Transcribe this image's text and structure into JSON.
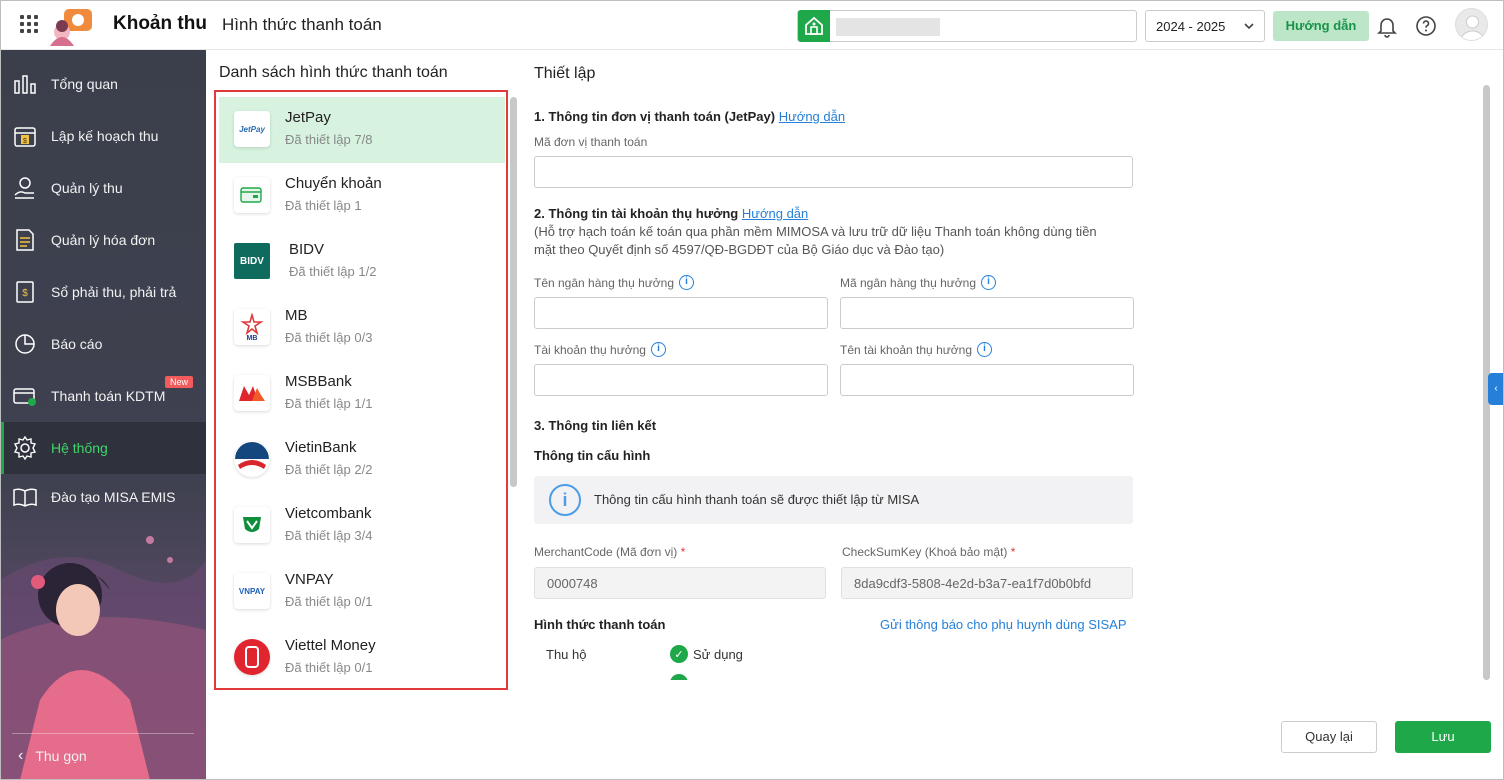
{
  "header": {
    "app_title": "Khoản thu",
    "page_title": "Hình thức thanh toán",
    "year": "2024 - 2025",
    "guide_label": "Hướng dẫn",
    "icons": [
      "apps-icon",
      "school-icon",
      "chevron-down-icon",
      "bell-icon",
      "help-icon",
      "avatar"
    ]
  },
  "sidebar": {
    "items": [
      {
        "label": "Tổng quan",
        "icon": "chart-icon"
      },
      {
        "label": "Lập kế hoạch thu",
        "icon": "calendar-money-icon"
      },
      {
        "label": "Quản lý thu",
        "icon": "money-hand-icon"
      },
      {
        "label": "Quản lý hóa đơn",
        "icon": "invoice-icon"
      },
      {
        "label": "Sổ phải thu, phải trả",
        "icon": "ledger-icon"
      },
      {
        "label": "Báo cáo",
        "icon": "pie-chart-icon"
      },
      {
        "label": "Thanh toán KDTM",
        "icon": "card-icon",
        "badge": "New"
      },
      {
        "label": "Hệ thống",
        "icon": "gear-icon",
        "active": true
      },
      {
        "label": "Đào tạo MISA EMIS",
        "icon": "book-icon"
      }
    ],
    "collapse_label": "Thu gọn",
    "active_color": "#3dd66a"
  },
  "payment_list": {
    "title": "Danh sách hình thức thanh toán",
    "items": [
      {
        "name": "JetPay",
        "status": "Đã thiết lập 7/8",
        "logo": "jetpay-logo",
        "logo_text": "JetPay"
      },
      {
        "name": "Chuyển khoản",
        "status": "Đã thiết lập 1",
        "logo": "bank-transfer-icon"
      },
      {
        "name": "BIDV",
        "status": "Đã thiết lập 1/2",
        "logo": "bidv-logo",
        "logo_text": "BIDV"
      },
      {
        "name": "MB",
        "status": "Đã thiết lập 0/3",
        "logo": "mb-logo",
        "logo_text": "MB"
      },
      {
        "name": "MSBBank",
        "status": "Đã thiết lập 1/1",
        "logo": "msb-logo"
      },
      {
        "name": "VietinBank",
        "status": "Đã thiết lập 2/2",
        "logo": "vietinbank-logo"
      },
      {
        "name": "Vietcombank",
        "status": "Đã thiết lập 3/4",
        "logo": "vietcombank-logo"
      },
      {
        "name": "VNPAY",
        "status": "Đã thiết lập 0/1",
        "logo": "vnpay-logo",
        "logo_text": "VNPAY"
      },
      {
        "name": "Viettel Money",
        "status": "Đã thiết lập 0/1",
        "logo": "viettel-money-logo"
      }
    ]
  },
  "setup": {
    "title": "Thiết lập",
    "section1": {
      "title": "1. Thông tin đơn vị thanh toán (JetPay)",
      "link": "Hướng dẫn",
      "field_label": "Mã đơn vị thanh toán",
      "field_value": ""
    },
    "section2": {
      "title": "2. Thông tin tài khoản thụ hưởng",
      "link": "Hướng dẫn",
      "note": "(Hỗ trợ hạch toán kế toán qua phần mềm MIMOSA và lưu trữ dữ liệu Thanh toán không dùng tiền mặt theo Quyết định số 4597/QĐ-BGDĐT của Bộ Giáo dục và Đào tạo)",
      "bank_name_label": "Tên ngân hàng thụ hưởng",
      "bank_code_label": "Mã ngân hàng thụ hưởng",
      "account_label": "Tài khoản thụ hưởng",
      "account_name_label": "Tên tài khoản thụ hưởng"
    },
    "section3": {
      "title": "3. Thông tin liên kết",
      "config_title": "Thông tin cấu hình",
      "info_text": "Thông tin cấu hình thanh toán sẽ được thiết lập từ MISA",
      "merchant_label": "MerchantCode (Mã đơn vị)",
      "merchant_value": "0000748",
      "checksum_label": "CheckSumKey (Khoá bảo mật)",
      "checksum_value": "8da9cdf3-5808-4e2d-b3a7-ea1f7d0b0bfd",
      "required_mark": "*",
      "payment_methods_title": "Hình thức thanh toán",
      "notify_link": "Gửi thông báo cho phụ huynh dùng SISAP",
      "method_label": "Thu hộ",
      "method_status": "Sử dụng"
    }
  },
  "footer": {
    "back_label": "Quay lại",
    "save_label": "Lưu"
  },
  "colors": {
    "accent": "#1ea84a",
    "link": "#2680d9",
    "highlight_border": "#e03a3a",
    "selected_bg": "#d7f3df"
  }
}
